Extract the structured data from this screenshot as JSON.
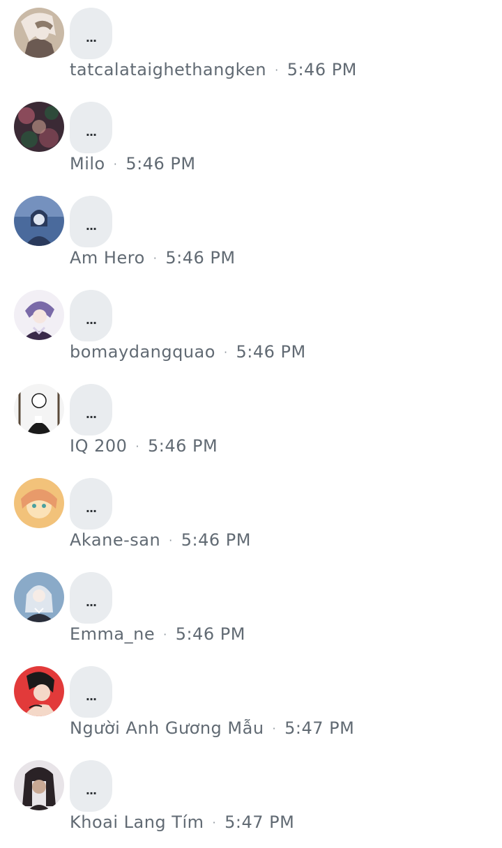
{
  "messages": [
    {
      "name": "tatcalataighethangken",
      "time": "5:46 PM",
      "text": "...",
      "avatar_icon": "anime-avatar-blond",
      "avatar_colors": [
        "#c9b9a6",
        "#6b5a52",
        "#efe6df"
      ]
    },
    {
      "name": "Milo",
      "time": "5:46 PM",
      "text": "...",
      "avatar_icon": "anime-avatar-dark-floral",
      "avatar_colors": [
        "#3b2a35",
        "#8a4a5a",
        "#2e4a3a"
      ]
    },
    {
      "name": "Am Hero",
      "time": "5:46 PM",
      "text": "...",
      "avatar_icon": "anime-avatar-blue-night",
      "avatar_colors": [
        "#4a6a9c",
        "#2a3a5c",
        "#9fb8e0"
      ]
    },
    {
      "name": "bomaydangquao",
      "time": "5:46 PM",
      "text": "...",
      "avatar_icon": "anime-avatar-purple-hair",
      "avatar_colors": [
        "#d8d0e8",
        "#7a6aa8",
        "#3a2a4a"
      ]
    },
    {
      "name": "IQ 200",
      "time": "5:46 PM",
      "text": "...",
      "avatar_icon": "anime-avatar-sketch",
      "avatar_colors": [
        "#f4f4f4",
        "#1a1a1a",
        "#8a8a8a"
      ]
    },
    {
      "name": "Akane-san",
      "time": "5:46 PM",
      "text": "...",
      "avatar_icon": "anime-avatar-blonde-girl",
      "avatar_colors": [
        "#f2c27a",
        "#e89a6a",
        "#fbe2b8"
      ]
    },
    {
      "name": "Emma_ne",
      "time": "5:46 PM",
      "text": "...",
      "avatar_icon": "anime-avatar-silver-girl",
      "avatar_colors": [
        "#8aaac8",
        "#dfe6ee",
        "#2a2e3a"
      ]
    },
    {
      "name": "Người Anh Gương Mẫu",
      "time": "5:47 PM",
      "text": "...",
      "avatar_icon": "anime-avatar-red-bg",
      "avatar_colors": [
        "#e23a3a",
        "#1a1a1a",
        "#f4d8c8"
      ]
    },
    {
      "name": "Khoai Lang Tím",
      "time": "5:47 PM",
      "text": "...",
      "avatar_icon": "anime-avatar-dark-hair-girl",
      "avatar_colors": [
        "#e8e4e8",
        "#2a2226",
        "#c8a894"
      ]
    }
  ],
  "meta_separator": "·"
}
